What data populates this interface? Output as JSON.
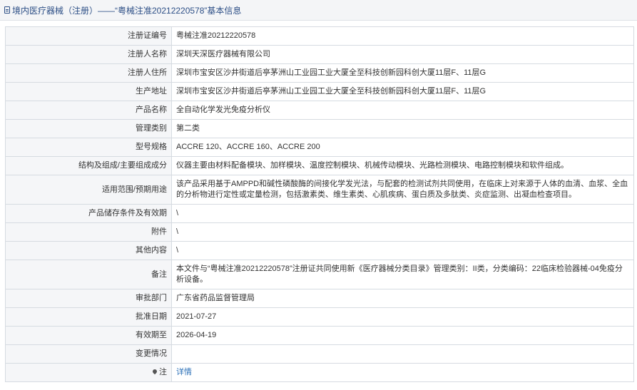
{
  "header": {
    "icon": "document-icon",
    "title": "境内医疗器械（注册）——“粤械注准20212220578”基本信息"
  },
  "rows": [
    {
      "label": "注册证编号",
      "value": "粤械注准20212220578"
    },
    {
      "label": "注册人名称",
      "value": "深圳天深医疗器械有限公司"
    },
    {
      "label": "注册人住所",
      "value": "深圳市宝安区沙井街道后亭茅洲山工业园工业大厦全至科技创新园科创大厦11层F、11层G"
    },
    {
      "label": "生产地址",
      "value": "深圳市宝安区沙井街道后亭茅洲山工业园工业大厦全至科技创新园科创大厦11层F、11层G"
    },
    {
      "label": "产品名称",
      "value": "全自动化学发光免疫分析仪"
    },
    {
      "label": "管理类别",
      "value": "第二类"
    },
    {
      "label": "型号规格",
      "value": "ACCRE 120、ACCRE 160、ACCRE 200"
    },
    {
      "label": "结构及组成/主要组成成分",
      "value": "仪器主要由材料配备模块、加样模块、温度控制模块、机械传动模块、光路检测模块、电路控制模块和软件组成。"
    },
    {
      "label": "适用范围/预期用途",
      "value": "该产品采用基于AMPPD和碱性磷酸酶的间接化学发光法，与配套的检测试剂共同使用，在临床上对来源于人体的血清、血浆、全血的分析物进行定性或定量检测，包括激素类、维生素类、心肌疾病、蛋白质及多肽类、炎症监测、出凝血检查项目。"
    },
    {
      "label": "产品储存条件及有效期",
      "value": "\\"
    },
    {
      "label": "附件",
      "value": "\\"
    },
    {
      "label": "其他内容",
      "value": "\\"
    },
    {
      "label": "备注",
      "value": "本文件与“粤械注准20212220578”注册证共同使用新《医疗器械分类目录》管理类别：II类，分类编码：22临床检验器械-04免疫分析设备。"
    },
    {
      "label": "审批部门",
      "value": "广东省药品监督管理局"
    },
    {
      "label": "批准日期",
      "value": "2021-07-27"
    },
    {
      "label": "有效期至",
      "value": "2026-04-19"
    },
    {
      "label": "变更情况",
      "value": ""
    }
  ],
  "note_row": {
    "icon": "pin-icon",
    "label": "注",
    "link_text": "详情"
  }
}
